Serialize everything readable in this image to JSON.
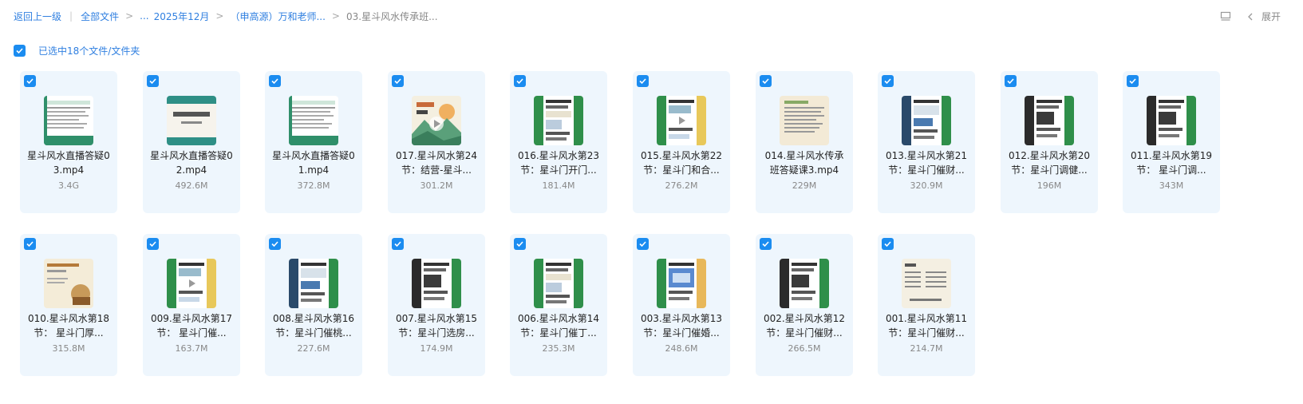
{
  "breadcrumb": {
    "back": "返回上一级",
    "all_files": "全部文件",
    "ellipsis": "...",
    "crumbs": [
      "2025年12月",
      "（申高源）万和老师...",
      "03.星斗风水传承班..."
    ]
  },
  "toolbar": {
    "expand_label": "展开"
  },
  "selection": {
    "summary": "已选中18个文件/文件夹"
  },
  "files": [
    {
      "name_line1": "星斗风水直播答疑0",
      "name_line2": "3.mp4",
      "size": "3.4G",
      "thumb": "doc-green"
    },
    {
      "name_line1": "星斗风水直播答疑0",
      "name_line2": "2.mp4",
      "size": "492.6M",
      "thumb": "title-teal"
    },
    {
      "name_line1": "星斗风水直播答疑0",
      "name_line2": "1.mp4",
      "size": "372.8M",
      "thumb": "doc-green"
    },
    {
      "name_line1": "017.星斗风水第24",
      "name_line2": "节：结营-星斗...",
      "size": "301.2M",
      "thumb": "landscape"
    },
    {
      "name_line1": "016.星斗风水第23",
      "name_line2": "节：星斗门开门...",
      "size": "181.4M",
      "thumb": "chat-green"
    },
    {
      "name_line1": "015.星斗风水第22",
      "name_line2": "节：星斗门和合...",
      "size": "276.2M",
      "thumb": "chat-play"
    },
    {
      "name_line1": "014.星斗风水传承",
      "name_line2": "班答疑课3.mp4",
      "size": "229M",
      "thumb": "beige-doc"
    },
    {
      "name_line1": "013.星斗风水第21",
      "name_line2": "节：星斗门催财...",
      "size": "320.9M",
      "thumb": "chat-navy"
    },
    {
      "name_line1": "012.星斗风水第20",
      "name_line2": "节：星斗门调健...",
      "size": "196M",
      "thumb": "chat-dark"
    },
    {
      "name_line1": "011.星斗风水第19",
      "name_line2": "节： 星斗门调...",
      "size": "343M",
      "thumb": "chat-dark"
    },
    {
      "name_line1": "010.星斗风水第18",
      "name_line2": "节： 星斗门厚...",
      "size": "315.8M",
      "thumb": "beige-photo"
    },
    {
      "name_line1": "009.星斗风水第17",
      "name_line2": "节： 星斗门催...",
      "size": "163.7M",
      "thumb": "chat-play"
    },
    {
      "name_line1": "008.星斗风水第16",
      "name_line2": "节：星斗门催桃...",
      "size": "227.6M",
      "thumb": "chat-navy"
    },
    {
      "name_line1": "007.星斗风水第15",
      "name_line2": "节：星斗门选房...",
      "size": "174.9M",
      "thumb": "chat-dark"
    },
    {
      "name_line1": "006.星斗风水第14",
      "name_line2": "节：星斗门催丁...",
      "size": "235.3M",
      "thumb": "chat-green"
    },
    {
      "name_line1": "003.星斗风水第13",
      "name_line2": "节：星斗门催婚...",
      "size": "248.6M",
      "thumb": "chat-blue"
    },
    {
      "name_line1": "002.星斗风水第12",
      "name_line2": "节：星斗门催财...",
      "size": "266.5M",
      "thumb": "chat-dark"
    },
    {
      "name_line1": "001.星斗风水第11",
      "name_line2": "节：星斗门催财...",
      "size": "214.7M",
      "thumb": "beige-list"
    }
  ]
}
